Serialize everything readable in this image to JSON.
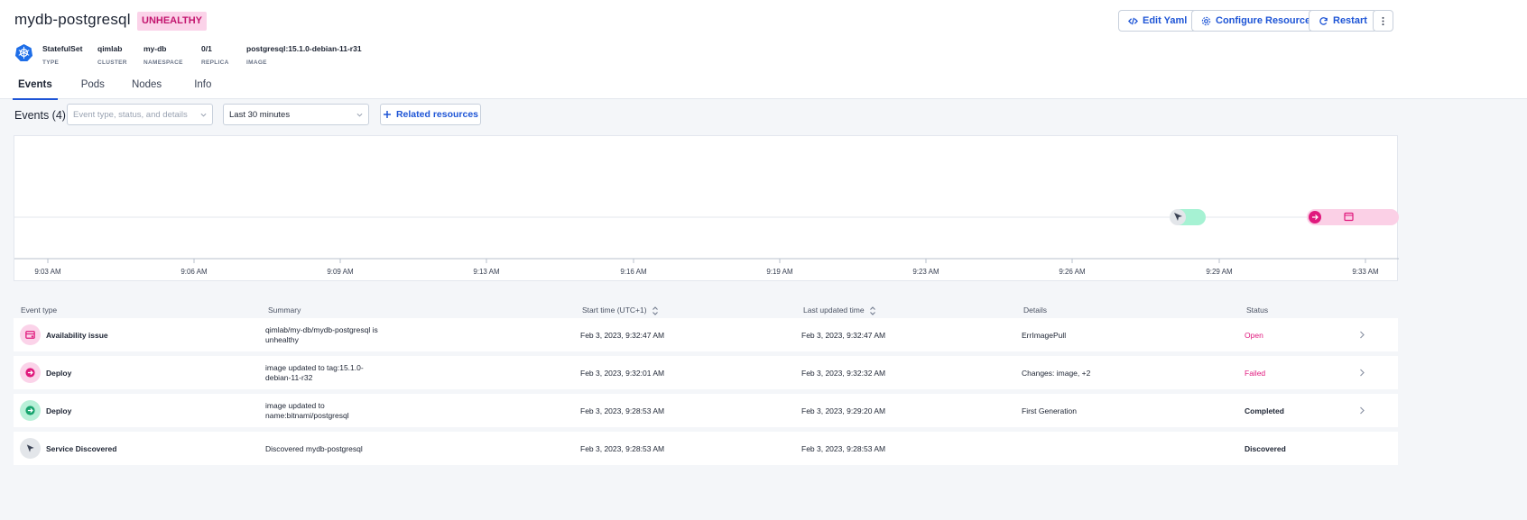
{
  "header": {
    "title": "mydb-postgresql",
    "badge": "UNHEALTHY",
    "buttons": {
      "edit_yaml": "Edit Yaml",
      "configure": "Configure Resources",
      "restart": "Restart"
    },
    "meta": [
      {
        "value": "StatefulSet",
        "label": "TYPE"
      },
      {
        "value": "qimlab",
        "label": "CLUSTER"
      },
      {
        "value": "my-db",
        "label": "NAMESPACE"
      },
      {
        "value": "0/1",
        "label": "REPLICA"
      },
      {
        "value": "postgresql:15.1.0-debian-11-r31",
        "label": "IMAGE"
      }
    ]
  },
  "tabs": [
    "Events",
    "Pods",
    "Nodes",
    "Info"
  ],
  "events": {
    "title": "Events (4)",
    "filter_placeholder": "Event type, status, and details",
    "time_range": "Last 30 minutes",
    "related_label": "Related resources"
  },
  "timeline": {
    "ticks": [
      "9:03 AM",
      "9:06 AM",
      "9:09 AM",
      "9:13 AM",
      "9:16 AM",
      "9:19 AM",
      "9:23 AM",
      "9:26 AM",
      "9:29 AM",
      "9:33 AM"
    ]
  },
  "table": {
    "headers": [
      "Event type",
      "Summary",
      "Start time (UTC+1)",
      "Last updated time",
      "Details",
      "Status"
    ],
    "rows": [
      {
        "type": "Availability issue",
        "summary1": "qimlab/my-db/mydb-postgresql is",
        "summary2": "unhealthy",
        "start": "Feb 3, 2023, 9:32:47 AM",
        "updated": "Feb 3, 2023, 9:32:47 AM",
        "details": "ErrImagePull",
        "status": "Open"
      },
      {
        "type": "Deploy",
        "summary1": "image updated to tag:15.1.0-",
        "summary2": "debian-11-r32",
        "start": "Feb 3, 2023, 9:32:01 AM",
        "updated": "Feb 3, 2023, 9:32:32 AM",
        "details": "Changes: image, +2",
        "status": "Failed"
      },
      {
        "type": "Deploy",
        "summary1": "image updated to",
        "summary2": "name:bitnami/postgresql",
        "start": "Feb 3, 2023, 9:28:53 AM",
        "updated": "Feb 3, 2023, 9:29:20 AM",
        "details": "First Generation",
        "status": "Completed"
      },
      {
        "type": "Service Discovered",
        "summary1": "Discovered mydb-postgresql",
        "summary2": "",
        "start": "Feb 3, 2023, 9:28:53 AM",
        "updated": "Feb 3, 2023, 9:28:53 AM",
        "details": "",
        "status": "Discovered"
      }
    ]
  },
  "colors": {
    "accent": "#1e55d6",
    "pink": "#e0197d",
    "green": "#18a46e",
    "unhealthy_bg": "#fbd3e9"
  }
}
